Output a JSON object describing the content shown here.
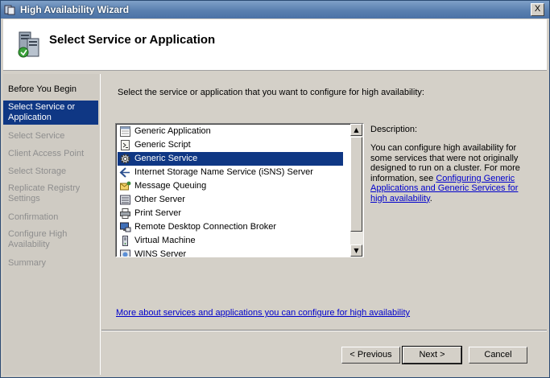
{
  "window": {
    "title": "High Availability Wizard",
    "close_glyph": "X"
  },
  "header": {
    "title": "Select Service or Application",
    "icon": "cluster-wizard-icon"
  },
  "sidebar": {
    "items": [
      {
        "label": "Before You Begin",
        "state": "done"
      },
      {
        "label": "Select Service or Application",
        "state": "current"
      },
      {
        "label": "Select Service",
        "state": "pending"
      },
      {
        "label": "Client Access Point",
        "state": "pending"
      },
      {
        "label": "Select Storage",
        "state": "pending"
      },
      {
        "label": "Replicate Registry Settings",
        "state": "pending"
      },
      {
        "label": "Confirmation",
        "state": "pending"
      },
      {
        "label": "Configure High Availability",
        "state": "pending"
      },
      {
        "label": "Summary",
        "state": "pending"
      }
    ]
  },
  "main": {
    "prompt": "Select the service or application that you want to configure for high availability:",
    "list": {
      "items": [
        {
          "label": "Generic Application",
          "icon": "application-window-icon"
        },
        {
          "label": "Generic Script",
          "icon": "script-icon"
        },
        {
          "label": "Generic Service",
          "icon": "gear-icon",
          "selected": true
        },
        {
          "label": "Internet Storage Name Service (iSNS) Server",
          "icon": "isns-arrows-icon"
        },
        {
          "label": "Message Queuing",
          "icon": "message-envelope-icon"
        },
        {
          "label": "Other Server",
          "icon": "server-icon"
        },
        {
          "label": "Print Server",
          "icon": "printer-icon"
        },
        {
          "label": "Remote Desktop Connection Broker",
          "icon": "remote-desktop-icon"
        },
        {
          "label": "Virtual Machine",
          "icon": "virtual-machine-icon"
        },
        {
          "label": "WINS Server",
          "icon": "wins-server-icon"
        }
      ],
      "scroll_up": "▲",
      "scroll_down": "▼"
    },
    "description": {
      "label": "Description:",
      "text": "You can configure high availability for some services that were not originally designed to run on a cluster. For more information, see ",
      "link": "Configuring Generic Applications and Generic Services for high availability",
      "suffix": "."
    },
    "more_link": "More about services and applications you can configure for high availability"
  },
  "buttons": {
    "previous": "< Previous",
    "next": "Next >",
    "cancel": "Cancel"
  },
  "colors": {
    "selection": "#0f3784",
    "link": "#0000cc"
  }
}
